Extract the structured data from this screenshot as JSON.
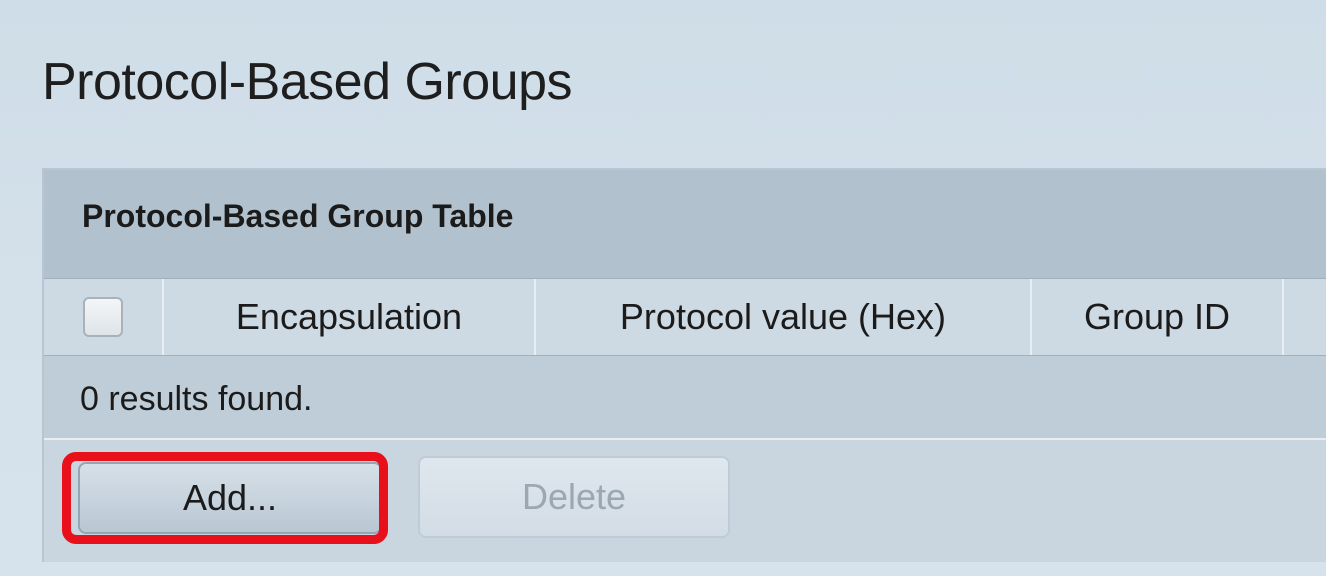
{
  "page": {
    "title": "Protocol-Based Groups"
  },
  "table": {
    "title": "Protocol-Based Group Table",
    "columns": [
      "Encapsulation",
      "Protocol value (Hex)",
      "Group ID"
    ],
    "results_text": "0 results found."
  },
  "buttons": {
    "add_label": "Add...",
    "delete_label": "Delete"
  },
  "colors": {
    "highlight": "#e8101a"
  },
  "icons": {
    "select_all": "checkbox-icon"
  }
}
